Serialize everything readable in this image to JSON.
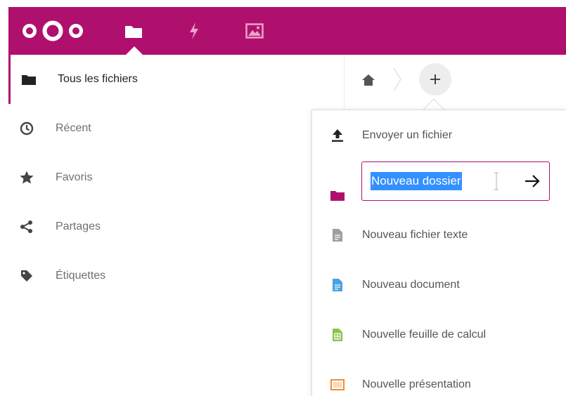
{
  "header": {
    "apps": [
      {
        "name": "files",
        "icon": "folder-icon"
      },
      {
        "name": "activity",
        "icon": "lightning-icon"
      },
      {
        "name": "gallery",
        "icon": "image-icon"
      }
    ],
    "colors": {
      "brand": "#b0106d"
    }
  },
  "sidebar": {
    "items": [
      {
        "label": "Tous les fichiers",
        "icon": "folder-icon",
        "active": true
      },
      {
        "label": "Récent",
        "icon": "clock-icon"
      },
      {
        "label": "Favoris",
        "icon": "star-icon"
      },
      {
        "label": "Partages",
        "icon": "share-icon"
      },
      {
        "label": "Étiquettes",
        "icon": "tag-icon"
      }
    ]
  },
  "breadcrumb": {
    "home_icon": "home-icon",
    "add_icon": "plus-icon"
  },
  "new_menu": {
    "items": [
      {
        "label": "Envoyer un fichier",
        "icon": "upload-icon"
      },
      {
        "label": "",
        "icon": "folder-icon",
        "input_value": "Nouveau dossier"
      },
      {
        "label": "Nouveau fichier texte",
        "icon": "text-file-icon"
      },
      {
        "label": "Nouveau document",
        "icon": "document-icon"
      },
      {
        "label": "Nouvelle feuille de calcul",
        "icon": "spreadsheet-icon"
      },
      {
        "label": "Nouvelle présentation",
        "icon": "presentation-icon"
      }
    ],
    "colors": {
      "document": "#4aa3df",
      "spreadsheet": "#8bc34a",
      "presentation": "#f08c3a",
      "folder": "#b0106d"
    }
  }
}
